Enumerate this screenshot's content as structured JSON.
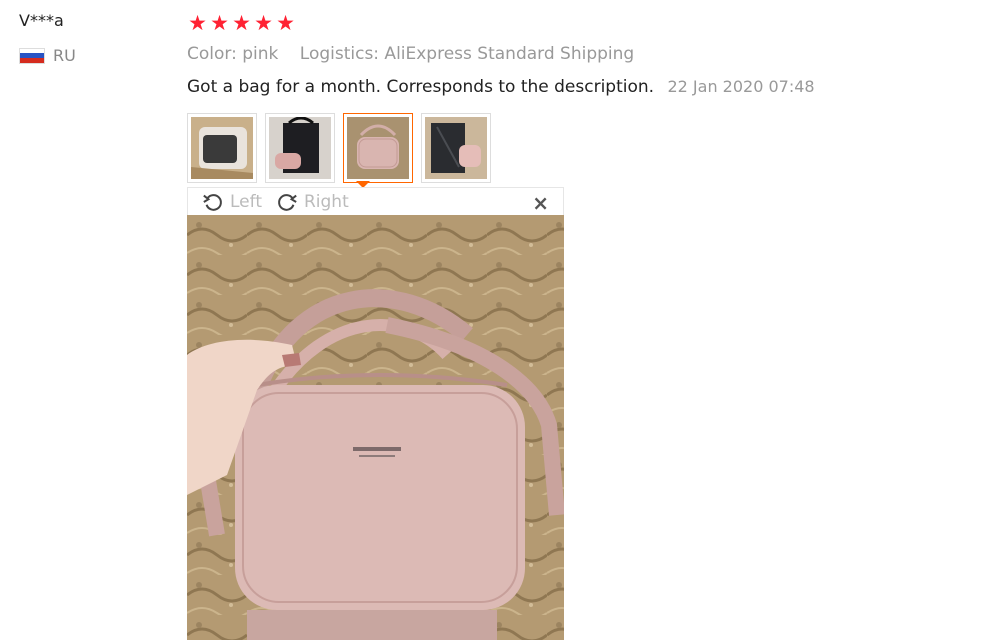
{
  "review": {
    "user_name": "V***a",
    "country_code": "RU",
    "rating": 5,
    "stars": [
      "★",
      "★",
      "★",
      "★",
      "★"
    ],
    "color": "Color: pink",
    "logistics": "Logistics: AliExpress Standard Shipping",
    "text": "Got a bag for a month. Corresponds to the description.",
    "date": "22 Jan 2020 07:48",
    "thumbnails": [
      {
        "id": "thumb-1",
        "active": false
      },
      {
        "id": "thumb-2",
        "active": false
      },
      {
        "id": "thumb-3",
        "active": true
      },
      {
        "id": "thumb-4",
        "active": false
      }
    ]
  },
  "viewer": {
    "rotate_left_label": "Left",
    "rotate_right_label": "Right",
    "close_icon": "×"
  },
  "colors": {
    "star": "#ff2233",
    "active_border": "#ff6600",
    "muted_text": "#999999",
    "bag_pink": "#dcb9b5",
    "carpet": "#b59a70"
  }
}
